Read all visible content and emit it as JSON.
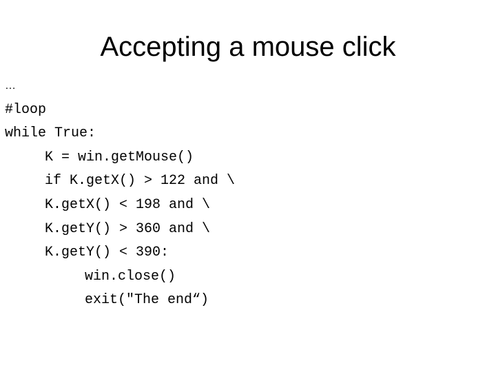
{
  "slide": {
    "title": "Accepting a mouse click",
    "code_lines": [
      {
        "text": "…",
        "indent": 0
      },
      {
        "text": "#loop",
        "indent": 0
      },
      {
        "text": "while True:",
        "indent": 0
      },
      {
        "text": "K = win.getMouse()",
        "indent": 1
      },
      {
        "text": "if K.getX() > 122 and \\",
        "indent": 1
      },
      {
        "text": "K.getX() < 198 and \\",
        "indent": 1
      },
      {
        "text": "K.getY() > 360 and \\",
        "indent": 1
      },
      {
        "text": "K.getY() < 390:",
        "indent": 1
      },
      {
        "text": "win.close()",
        "indent": 2
      },
      {
        "text": "exit(\"The end“)",
        "indent": 2
      }
    ]
  }
}
